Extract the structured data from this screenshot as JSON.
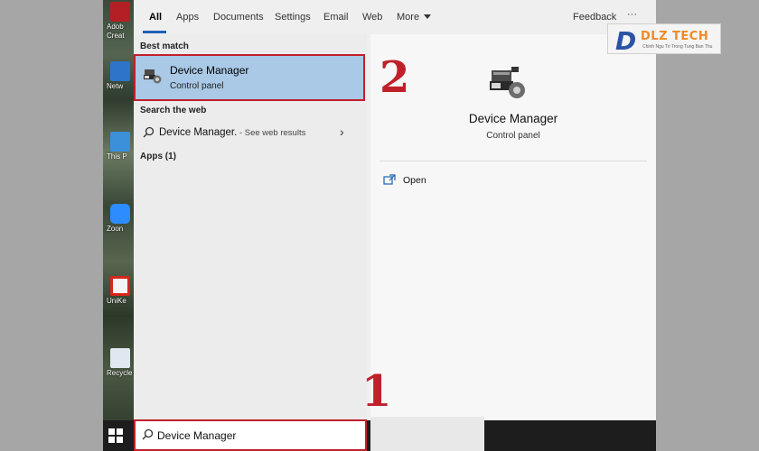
{
  "desktop": {
    "icons": [
      {
        "label": "Adob",
        "label2": "Creat",
        "icon": "adobe-icon",
        "color": "#b41f24"
      },
      {
        "label": "Netw",
        "icon": "network-icon",
        "color": "#2e74c8"
      },
      {
        "label": "This P",
        "icon": "computer-icon",
        "color": "#3c8fd9"
      },
      {
        "label": "Zoon",
        "icon": "zoom-icon",
        "color": "#2d8cff"
      },
      {
        "label": "UniKe",
        "icon": "unikey-icon",
        "color": "#d6261c"
      },
      {
        "label": "Recycle",
        "icon": "recycle-bin-icon",
        "color": "#dfe8f0"
      }
    ]
  },
  "tabs": [
    {
      "label": "All",
      "active": true
    },
    {
      "label": "Apps"
    },
    {
      "label": "Documents"
    },
    {
      "label": "Settings"
    },
    {
      "label": "Email"
    },
    {
      "label": "Web"
    },
    {
      "label": "More",
      "icon": "caret-down-icon"
    }
  ],
  "header_right": {
    "feedback": "Feedback",
    "more": "···"
  },
  "left": {
    "best_match_heading": "Best match",
    "best_match": {
      "title": "Device Manager",
      "subtitle": "Control panel",
      "icon": "device-manager-icon"
    },
    "web_heading": "Search the web",
    "web_result": {
      "query": "Device Manager.",
      "suffix": " - See web results"
    },
    "apps_heading": "Apps (1)"
  },
  "preview": {
    "title": "Device Manager",
    "subtitle": "Control panel",
    "actions": [
      {
        "label": "Open",
        "icon": "open-icon"
      }
    ]
  },
  "search": {
    "value": "Device Manager"
  },
  "annotations": {
    "step1": "1",
    "step2": "2",
    "color": "#c0202a"
  },
  "logo": {
    "letter": "D",
    "name": "DLZ TECH",
    "tagline": "Chinh Ngu Tri Trong Tung Ban Thu"
  },
  "colors": {
    "accent": "#1f62b4",
    "selection": "#a9c9e6",
    "highlight": "#c0202a"
  }
}
